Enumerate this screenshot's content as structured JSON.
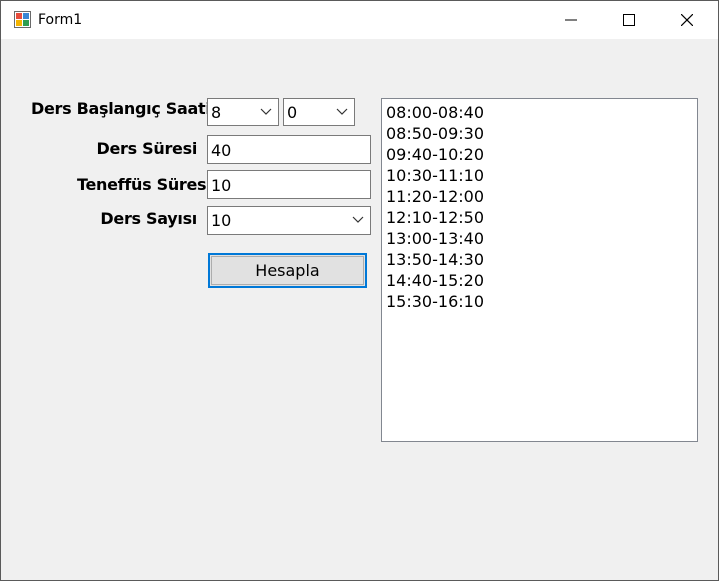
{
  "window": {
    "title": "Form1"
  },
  "labels": {
    "start_time": "Ders Başlangıç Saati",
    "duration": "Ders Süresi",
    "break": "Teneffüs Süresi",
    "count": "Ders Sayısı"
  },
  "fields": {
    "start_hour": "8",
    "start_minute": "0",
    "duration": "40",
    "break": "10",
    "count": "10"
  },
  "button": {
    "calculate": "Hesapla"
  },
  "schedule": [
    "08:00-08:40",
    "08:50-09:30",
    "09:40-10:20",
    "10:30-11:10",
    "11:20-12:00",
    "12:10-12:50",
    "13:00-13:40",
    "13:50-14:30",
    "14:40-15:20",
    "15:30-16:10"
  ],
  "colors": {
    "focus_border": "#0078d7",
    "form_bg": "#f0f0f0"
  }
}
